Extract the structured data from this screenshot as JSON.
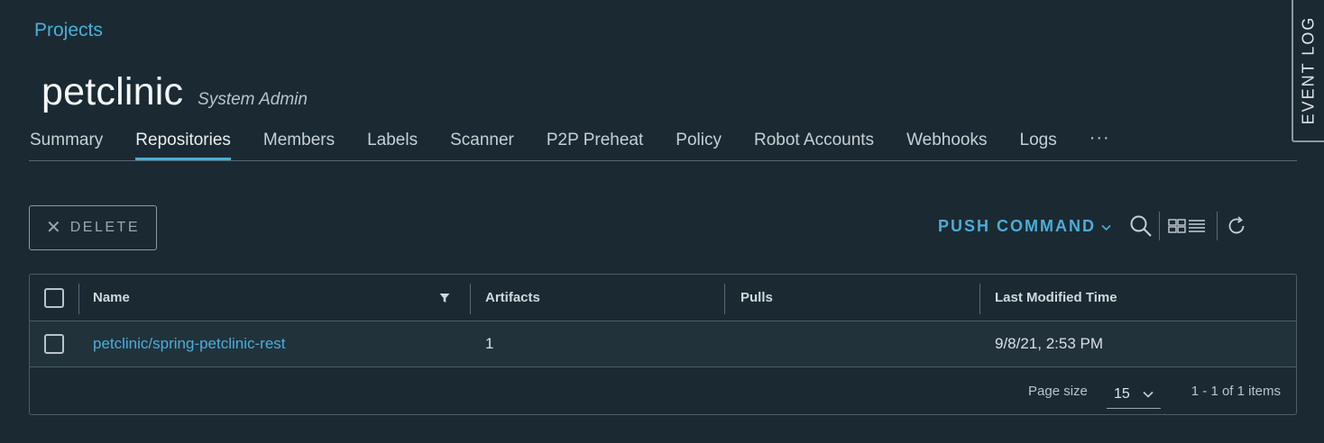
{
  "breadcrumb": "Projects",
  "project": {
    "title": "petclinic",
    "role": "System Admin"
  },
  "tabs": [
    {
      "label": "Summary"
    },
    {
      "label": "Repositories",
      "active": true
    },
    {
      "label": "Members"
    },
    {
      "label": "Labels"
    },
    {
      "label": "Scanner"
    },
    {
      "label": "P2P Preheat"
    },
    {
      "label": "Policy"
    },
    {
      "label": "Robot Accounts"
    },
    {
      "label": "Webhooks"
    },
    {
      "label": "Logs"
    }
  ],
  "tabs_more": "···",
  "event_log": "EVENT LOG",
  "toolbar": {
    "delete_label": "DELETE",
    "push_command_label": "PUSH COMMAND",
    "icons": [
      "search-icon",
      "card-view-icon",
      "list-view-icon",
      "refresh-icon"
    ]
  },
  "grid": {
    "columns": [
      "Name",
      "Artifacts",
      "Pulls",
      "Last Modified Time"
    ],
    "rows": [
      {
        "name": "petclinic/spring-petclinic-rest",
        "artifacts": "1",
        "pulls": "",
        "modified": "9/8/21, 2:53 PM"
      }
    ],
    "footer": {
      "page_size_label": "Page size",
      "page_size": "15",
      "items": "1 - 1 of 1 items"
    }
  },
  "colors": {
    "background": "#1b2a32",
    "accent": "#4aaed9",
    "row": "#22323b",
    "border": "#4d5d67"
  }
}
